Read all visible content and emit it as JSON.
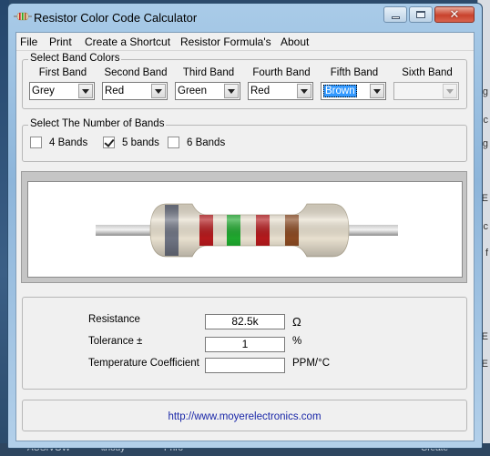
{
  "window": {
    "title": "Resistor Color Code Calculator"
  },
  "menu": {
    "items": [
      "File",
      "Print",
      "Create a Shortcut",
      "Resistor Formula's",
      "About"
    ]
  },
  "band_colors": {
    "group_label": "Select Band Colors",
    "bands": [
      {
        "title": "First Band",
        "value": "Grey"
      },
      {
        "title": "Second Band",
        "value": "Red"
      },
      {
        "title": "Third Band",
        "value": "Green"
      },
      {
        "title": "Fourth Band",
        "value": "Red"
      },
      {
        "title": "Fifth Band",
        "value": "Brown"
      },
      {
        "title": "Sixth Band",
        "value": ""
      }
    ]
  },
  "band_count": {
    "group_label": "Select The Number of Bands",
    "options": [
      {
        "label": "4 Bands",
        "checked": false
      },
      {
        "label": "5 bands",
        "checked": true
      },
      {
        "label": "6 Bands",
        "checked": false
      }
    ]
  },
  "resistor_image": {
    "body_color": "#e8e0cf",
    "band_colors": [
      "#6f7483",
      "#b4191c",
      "#1fa82e",
      "#b4191c",
      "#8a4a22"
    ]
  },
  "results": {
    "resistance_label": "Resistance",
    "resistance_value": "82.5k",
    "resistance_unit": "Ω",
    "tolerance_label": "Tolerance ±",
    "tolerance_value": "1",
    "tolerance_unit": "%",
    "tempco_label": "Temperature Coefficient",
    "tempco_value": "",
    "tempco_unit": "PPM/°C"
  },
  "footer": {
    "url": "http://www.moyerelectronics.com"
  },
  "background": {
    "right_chars": [
      "g",
      "c",
      "g",
      "E",
      "c",
      "f",
      "E",
      "E"
    ],
    "bottom_texts": [
      "AUSIVOW",
      "\\thouy",
      "Phro",
      "Create"
    ]
  }
}
